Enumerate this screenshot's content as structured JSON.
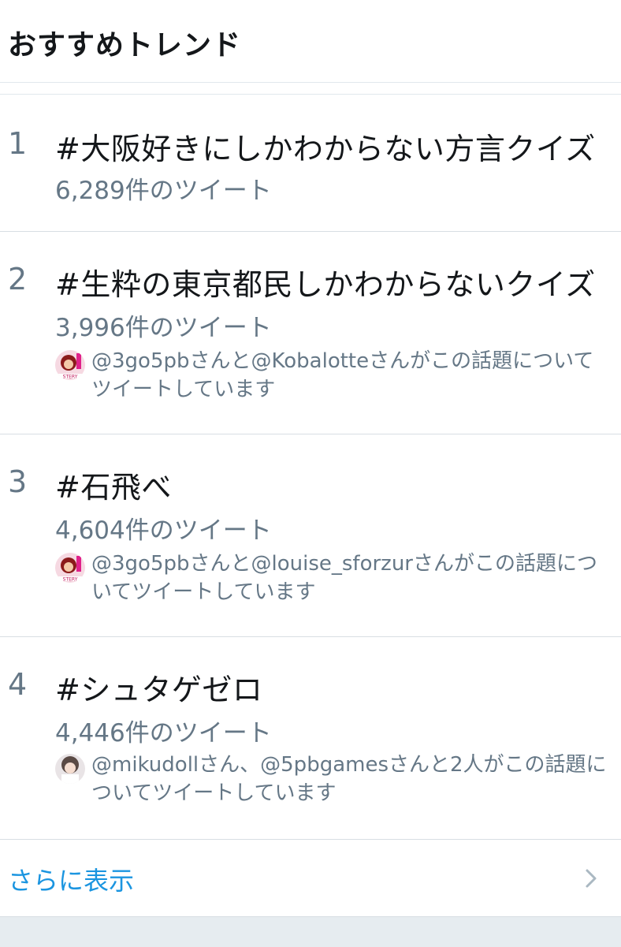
{
  "header": {
    "title": "おすすめトレンド"
  },
  "trends": [
    {
      "rank": "1",
      "name": "#大阪好きにしかわからない方言クイズ",
      "tweet_count": "6,289件のツイート"
    },
    {
      "rank": "2",
      "name": "#生粋の東京都民しかわからないクイズ",
      "tweet_count": "3,996件のツイート",
      "context": "@3go5pbさんと@Kobalotteさんがこの話題についてツイートしています"
    },
    {
      "rank": "3",
      "name": "#石飛べ",
      "tweet_count": "4,604件のツイート",
      "context": "@3go5pbさんと@louise_sforzurさんがこの話題についてツイートしています"
    },
    {
      "rank": "4",
      "name": "#シュタゲゼロ",
      "tweet_count": "4,446件のツイート",
      "context": "@mikudollさん、@5pbgamesさんと2人がこの話題についてツイートしています"
    }
  ],
  "show_more": {
    "label": "さらに表示",
    "icon": "chevron-right-icon"
  },
  "colors": {
    "primary_text": "#14171a",
    "secondary_text": "#657786",
    "link": "#1b95e0",
    "divider": "#d8dee3",
    "background_band": "#e6ecf0"
  }
}
